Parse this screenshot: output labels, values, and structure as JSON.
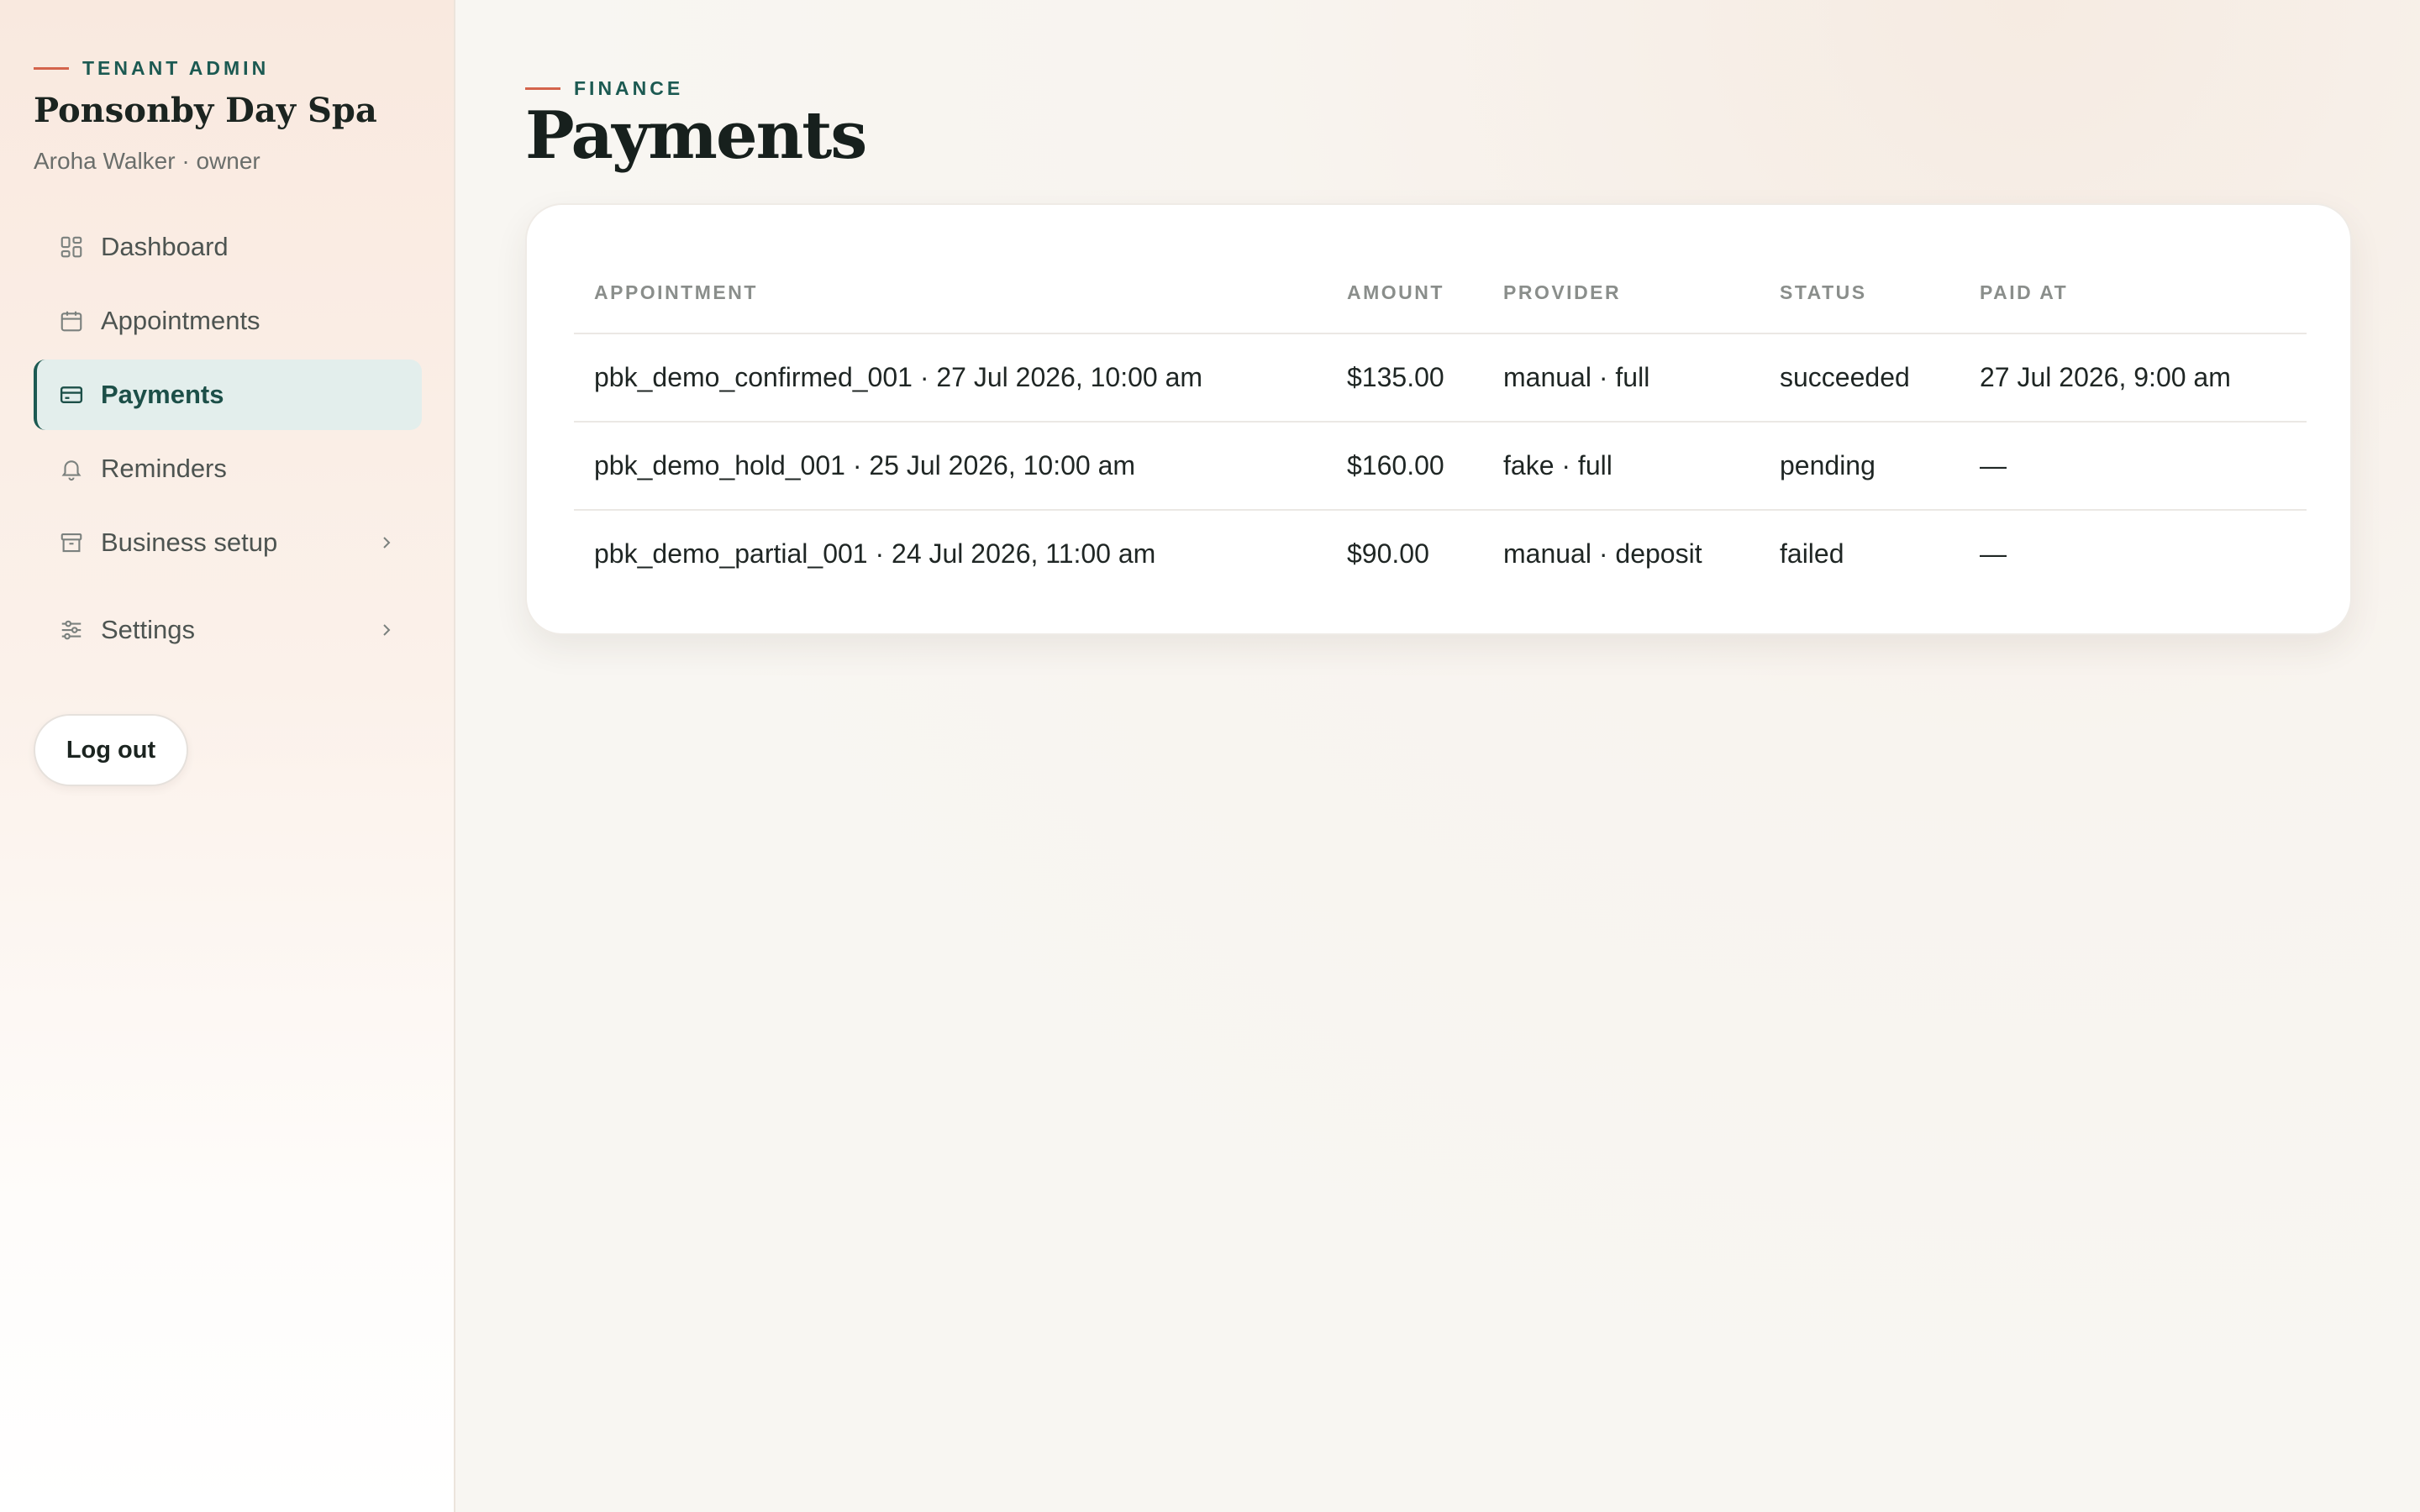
{
  "sidebar": {
    "eyebrow": "TENANT ADMIN",
    "business_name": "Ponsonby Day Spa",
    "user_line": "Aroha Walker · owner",
    "nav": [
      {
        "label": "Dashboard",
        "icon": "dashboard-icon"
      },
      {
        "label": "Appointments",
        "icon": "calendar-icon"
      },
      {
        "label": "Payments",
        "icon": "credit-card-icon",
        "active": true
      },
      {
        "label": "Reminders",
        "icon": "bell-icon"
      },
      {
        "label": "Business setup",
        "icon": "store-icon",
        "expandable": true
      },
      {
        "label": "Settings",
        "icon": "sliders-icon",
        "expandable": true
      }
    ],
    "logout_label": "Log out"
  },
  "header": {
    "eyebrow": "FINANCE",
    "title": "Payments"
  },
  "payments_table": {
    "columns": [
      "APPOINTMENT",
      "AMOUNT",
      "PROVIDER",
      "STATUS",
      "PAID AT"
    ],
    "rows": [
      [
        "pbk_demo_confirmed_001 · 27 Jul 2026, 10:00 am",
        "$135.00",
        "manual · full",
        "succeeded",
        "27 Jul 2026, 9:00 am"
      ],
      [
        "pbk_demo_hold_001 · 25 Jul 2026, 10:00 am",
        "$160.00",
        "fake · full",
        "pending",
        "—"
      ],
      [
        "pbk_demo_partial_001 · 24 Jul 2026, 11:00 am",
        "$90.00",
        "manual · deposit",
        "failed",
        "—"
      ]
    ]
  },
  "colors": {
    "accent_teal": "#1c5a52",
    "accent_coral": "#d4644c",
    "active_nav_bg": "#e3eeec"
  }
}
